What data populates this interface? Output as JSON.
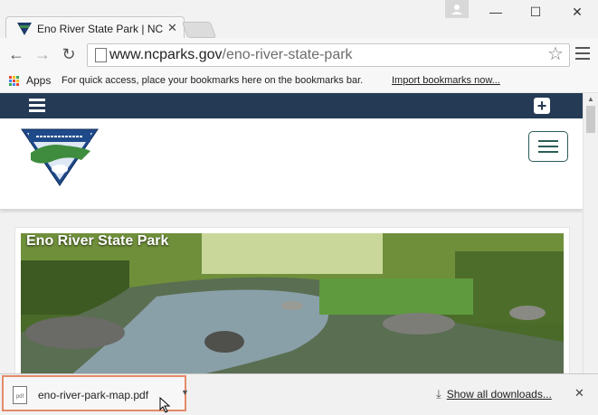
{
  "tab": {
    "title": "Eno River State Park | NC S",
    "close_glyph": "✕"
  },
  "window": {
    "minimize_glyph": "—",
    "maximize_glyph": "☐",
    "close_glyph": "✕"
  },
  "toolbar": {
    "back_glyph": "←",
    "forward_glyph": "→",
    "reload_glyph": "↻",
    "url_host": "www.ncparks.gov",
    "url_path": "/eno-river-state-park",
    "star_glyph": "☆"
  },
  "bookmarks": {
    "apps_label": "Apps",
    "hint": "For quick access, place your bookmarks here on the bookmarks bar.",
    "import_label": "Import bookmarks now..."
  },
  "site": {
    "nav_plus": "+",
    "hero_title": "Eno River State Park",
    "nav_color": "#253a55"
  },
  "downloads": {
    "file_name": "eno-river-park-map.pdf",
    "file_type": "pdf",
    "show_all_label": "Show all downloads...",
    "close_glyph": "✕",
    "highlight_color": "#e58a6a"
  },
  "scrollbar": {
    "up_glyph": "▲"
  }
}
